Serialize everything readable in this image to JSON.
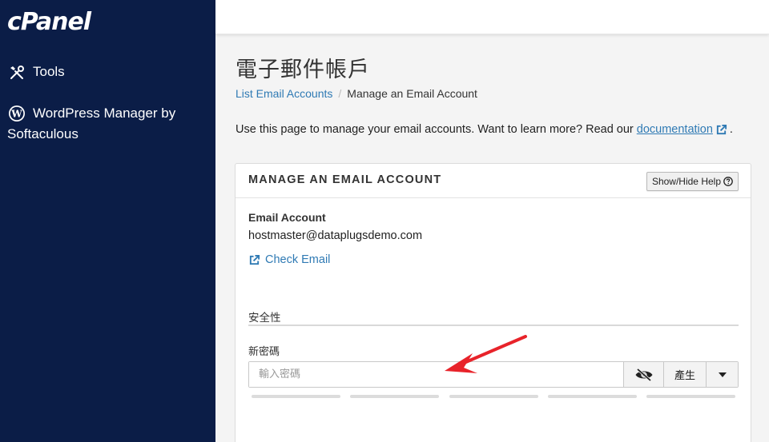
{
  "sidebar": {
    "brand": "cPanel",
    "items": [
      {
        "label": "Tools",
        "icon": "tools-icon"
      },
      {
        "label": "WordPress Manager by",
        "label_line2": "Softaculous",
        "icon": "wordpress-icon"
      }
    ]
  },
  "page": {
    "title": "電子郵件帳戶",
    "breadcrumb": {
      "link": "List Email Accounts",
      "separator": "/",
      "current": "Manage an Email Account"
    },
    "intro_text": "Use this page to manage your email accounts. Want to learn more? Read our",
    "intro_link": "documentation",
    "intro_end": "."
  },
  "panel": {
    "title": "MANAGE AN EMAIL ACCOUNT",
    "help_button": "Show/Hide Help",
    "email_account_label": "Email Account",
    "email_account_value": "hostmaster@dataplugsdemo.com",
    "check_email": "Check Email",
    "security_section": "安全性",
    "new_password_label": "新密碼",
    "password_placeholder": "輸入密碼",
    "generate_button": "產生"
  },
  "colors": {
    "sidebar_bg": "#0b1d47",
    "link": "#2f7ab4",
    "arrow": "#e8232a"
  }
}
